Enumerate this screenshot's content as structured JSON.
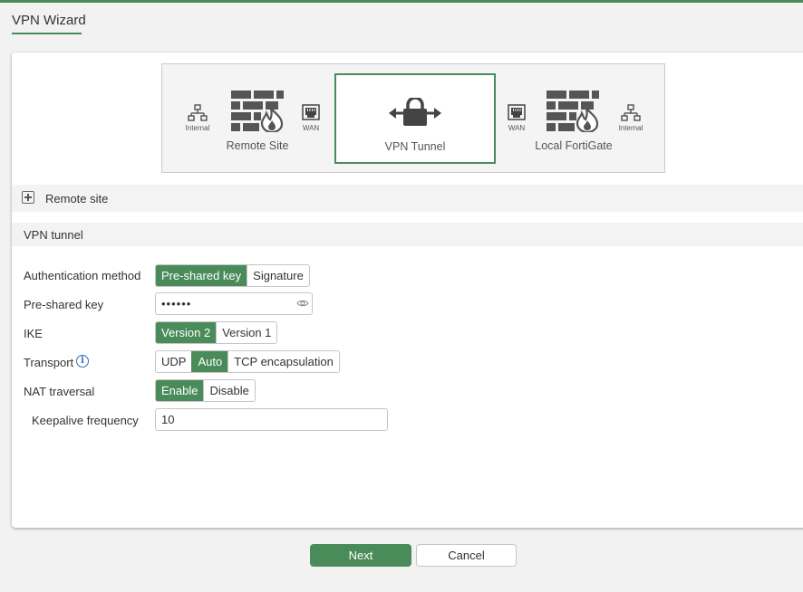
{
  "header": {
    "title": "VPN Wizard"
  },
  "diagram": {
    "left": {
      "label": "Remote Site",
      "internal_label": "Internal",
      "wan_label": "WAN"
    },
    "center": {
      "label": "VPN Tunnel"
    },
    "right": {
      "label": "Local FortiGate",
      "internal_label": "Internal",
      "wan_label": "WAN"
    }
  },
  "sections": {
    "remote_site": "Remote site",
    "vpn_tunnel": "VPN tunnel"
  },
  "form": {
    "auth_method": {
      "label": "Authentication method",
      "options": [
        "Pre-shared key",
        "Signature"
      ],
      "selected": "Pre-shared key"
    },
    "psk": {
      "label": "Pre-shared key",
      "value": "••••••"
    },
    "ike": {
      "label": "IKE",
      "options": [
        "Version 2",
        "Version 1"
      ],
      "selected": "Version 2"
    },
    "transport": {
      "label": "Transport",
      "options": [
        "UDP",
        "Auto",
        "TCP encapsulation"
      ],
      "selected": "Auto"
    },
    "nat": {
      "label": "NAT traversal",
      "options": [
        "Enable",
        "Disable"
      ],
      "selected": "Enable"
    },
    "keepalive": {
      "label": "Keepalive frequency",
      "value": "10"
    }
  },
  "footer": {
    "next_label": "Next",
    "cancel_label": "Cancel"
  },
  "colors": {
    "accent": "#4a8c59",
    "info": "#2f73b6"
  },
  "icons": [
    "network-icon",
    "firewall-icon",
    "wan-port-icon",
    "lock-icon",
    "eye-icon",
    "info-icon",
    "plus-icon"
  ]
}
